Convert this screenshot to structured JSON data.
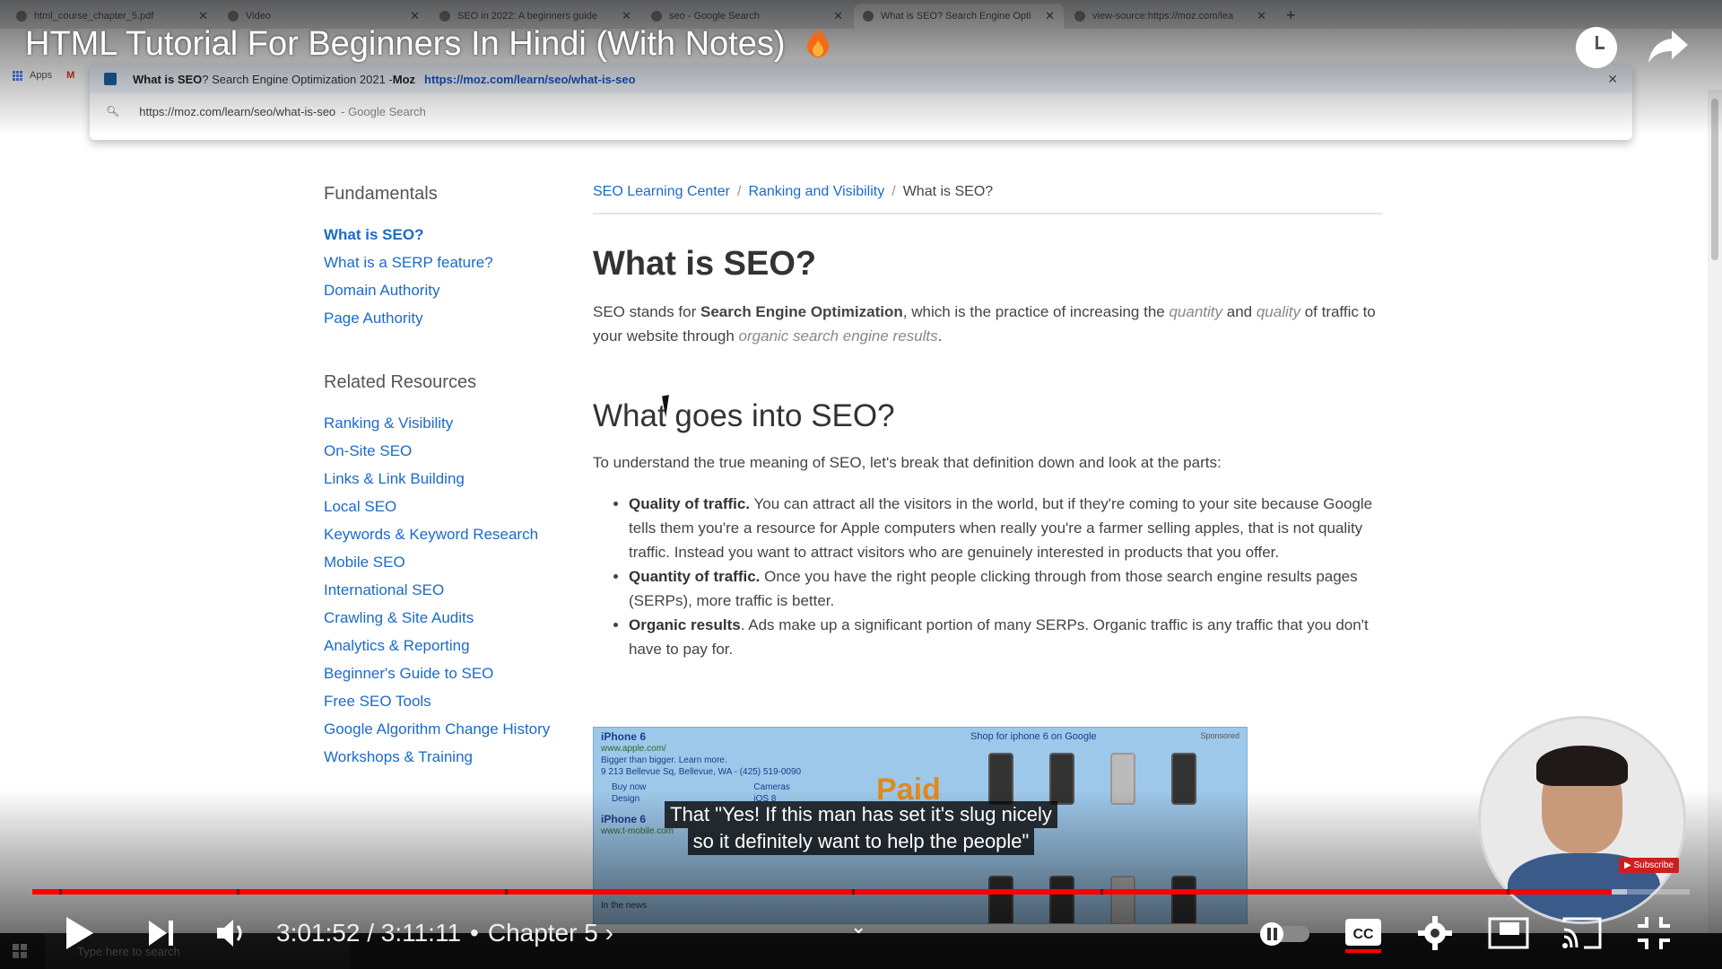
{
  "browser": {
    "tabs": [
      {
        "label": "html_course_chapter_5.pdf",
        "active": false
      },
      {
        "label": "Video",
        "active": false
      },
      {
        "label": "SEO in 2022: A beginners guide",
        "active": false
      },
      {
        "label": "seo - Google Search",
        "active": false
      },
      {
        "label": "What is SEO? Search Engine Opti",
        "active": true
      },
      {
        "label": "view-source:https://moz.com/lea",
        "active": false
      }
    ],
    "bookmarks": {
      "apps": "Apps"
    },
    "omnibox": {
      "suggestion_title_bold": "What is SEO",
      "suggestion_title_rest": "? Search Engine Optimization 2021 - ",
      "suggestion_site": "Moz",
      "suggestion_url": "https://moz.com/learn/seo/what-is-seo",
      "typed_url": "https://moz.com/learn/seo/what-is-seo",
      "typed_suffix": "- Google Search"
    }
  },
  "sidebar": {
    "fundamentals_heading": "Fundamentals",
    "fundamentals": [
      {
        "label": "What is SEO?",
        "active": true
      },
      {
        "label": "What is a SERP feature?",
        "active": false
      },
      {
        "label": "Domain Authority",
        "active": false
      },
      {
        "label": "Page Authority",
        "active": false
      }
    ],
    "related_heading": "Related Resources",
    "related": [
      "Ranking & Visibility",
      "On-Site SEO",
      "Links & Link Building",
      "Local SEO",
      "Keywords & Keyword Research",
      "Mobile SEO",
      "International SEO",
      "Crawling & Site Audits",
      "Analytics & Reporting",
      "Beginner's Guide to SEO",
      "Free SEO Tools",
      "Google Algorithm Change History",
      "Workshops & Training"
    ]
  },
  "article": {
    "breadcrumb": [
      "SEO Learning Center",
      "Ranking and Visibility",
      "What is SEO?"
    ],
    "title": "What is SEO?",
    "intro": {
      "p1": "SEO stands for ",
      "b1": "Search Engine Optimization",
      "p2": ", which is the practice of increasing the ",
      "i1": "quantity",
      "p3": " and ",
      "i2": "quality",
      "p4": " of traffic to your website through ",
      "i3": "organic search engine results",
      "p5": "."
    },
    "subtitle": "What goes into SEO?",
    "lead": "To understand the true meaning of SEO, let's break that definition down and look at the parts:",
    "bullets": [
      {
        "bold": "Quality of traffic.",
        "text": " You can attract all the visitors in the world, but if they're coming to your site because Google tells them you're a resource for Apple computers when really you're a farmer selling apples, that is not quality traffic. Instead you want to attract visitors who are genuinely interested in products that you offer."
      },
      {
        "bold": "Quantity of traffic.",
        "text": " Once you have the right people clicking through from those search engine results pages (SERPs), more traffic is better."
      },
      {
        "bold": "Organic results",
        "text": ". Ads make up a significant portion of many SERPs. Organic traffic is any traffic that you don't have to pay for."
      }
    ],
    "serp_image": {
      "ad1_title": "iPhone 6",
      "ad1_url": "www.apple.com/",
      "ad1_desc": "Bigger than bigger. Learn more.",
      "ad1_addr": "9 213 Bellevue Sq, Bellevue, WA - (425) 519-0090",
      "ad1_links": [
        "Buy now",
        "Cameras",
        "Design",
        "iOS 8"
      ],
      "ad2_title": "iPhone 6",
      "ad2_url": "www.t-mobile.com",
      "paid_label": "Paid",
      "shopping_heading": "Shop for iphone 6 on Google",
      "sponsored": "Sponsored",
      "in_the_news": "In the news"
    }
  },
  "video": {
    "title": "HTML Tutorial For Beginners In Hindi (With Notes)",
    "captions": [
      "That \"Yes! If this man has set it's slug nicely",
      "so it definitely want to help the people\""
    ],
    "current_time": "3:01:52",
    "duration": "3:11:11",
    "chapter": "Chapter 5",
    "subscribe_label": "Subscribe",
    "progress_played": 0.953,
    "progress_loaded": 0.962
  },
  "taskbar": {
    "search_placeholder": "Type here to search"
  }
}
